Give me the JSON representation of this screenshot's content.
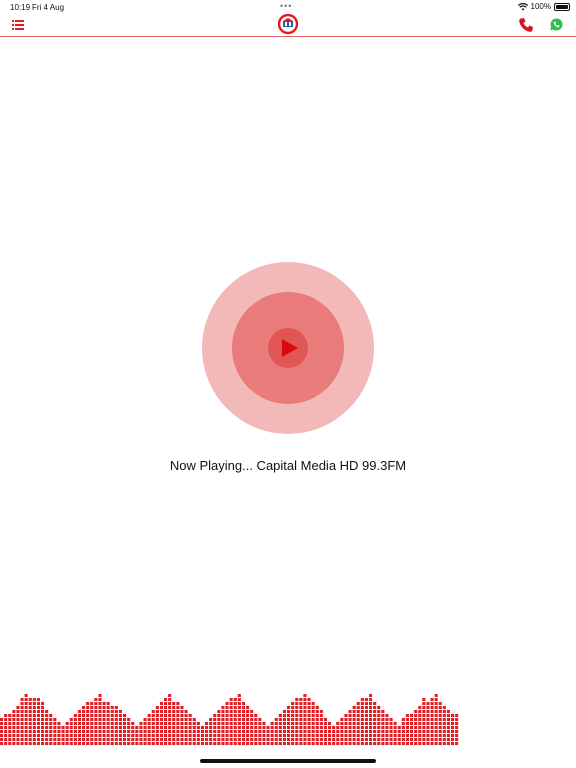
{
  "status_bar": {
    "time": "10:19",
    "date": "Fri 4 Aug",
    "battery": "100%",
    "dots": "•••"
  },
  "header": {
    "menu_icon": "list-icon",
    "logo_icon": "station-logo",
    "call_icon": "phone-icon",
    "whatsapp_icon": "whatsapp-icon"
  },
  "player": {
    "state": "stopped",
    "now_playing": "Now Playing... Capital Media HD 99.3FM"
  },
  "colors": {
    "accent": "#e31b23",
    "outer_ring": "#f3b9b9",
    "inner_ring": "#e97b7b",
    "play_circle": "#e25555",
    "equalizer": "#dd1f26"
  },
  "equalizer": {
    "levels": [
      7,
      8,
      8,
      9,
      10,
      12,
      13,
      12,
      12,
      12,
      11,
      9,
      8,
      7,
      6,
      5,
      6,
      7,
      8,
      9,
      10,
      11,
      11,
      12,
      13,
      11,
      11,
      10,
      10,
      9,
      8,
      7,
      6,
      5,
      6,
      7,
      8,
      9,
      10,
      11,
      12,
      13,
      11,
      11,
      10,
      9,
      8,
      7,
      6,
      5,
      6,
      7,
      8,
      9,
      10,
      11,
      12,
      12,
      13,
      11,
      10,
      9,
      8,
      7,
      6,
      5,
      6,
      7,
      8,
      9,
      10,
      11,
      12,
      12,
      13,
      12,
      11,
      10,
      9,
      7,
      6,
      5,
      6,
      7,
      8,
      9,
      10,
      11,
      12,
      12,
      13,
      11,
      10,
      9,
      8,
      7,
      6,
      5,
      7,
      8,
      8,
      9,
      10,
      12,
      11,
      12,
      13,
      11,
      10,
      9,
      8,
      8
    ]
  }
}
